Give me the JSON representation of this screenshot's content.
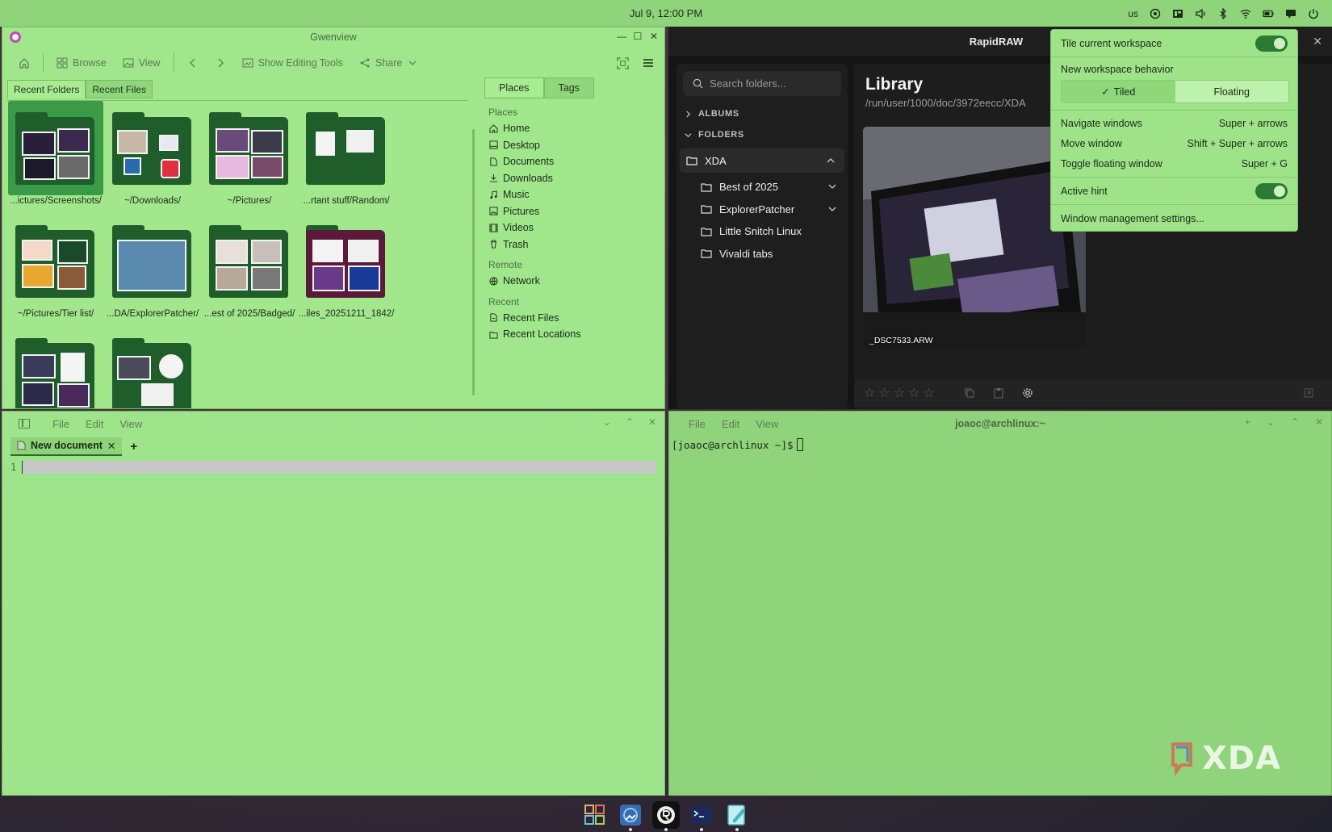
{
  "topbar": {
    "clock": "Jul 9, 12:00 PM",
    "keyboard_layout": "us"
  },
  "gwenview": {
    "title": "Gwenview",
    "toolbar": {
      "browse": "Browse",
      "view": "View",
      "show_editing_tools": "Show Editing Tools",
      "share": "Share"
    },
    "tabs": [
      "Recent Folders",
      "Recent Files"
    ],
    "folders": [
      "...ictures/Screenshots/",
      "~/Downloads/",
      "~/Pictures/",
      "...rtant stuff/Random/",
      "~/Pictures/Tier list/",
      "...DA/ExplorerPatcher/",
      "...est of 2025/Badged/",
      "...iles_20251211_1842/"
    ],
    "places_tabs": [
      "Places",
      "Tags"
    ],
    "places": {
      "heading_places": "Places",
      "items_places": [
        "Home",
        "Desktop",
        "Documents",
        "Downloads",
        "Music",
        "Pictures",
        "Videos",
        "Trash"
      ],
      "heading_remote": "Remote",
      "items_remote": [
        "Network"
      ],
      "heading_recent": "Recent",
      "items_recent": [
        "Recent Files",
        "Recent Locations"
      ]
    }
  },
  "rapidraw": {
    "title": "RapidRAW",
    "search_placeholder": "Search folders...",
    "albums": "ALBUMS",
    "folders_label": "FOLDERS",
    "root_folder": "XDA",
    "subfolders": [
      "Best of 2025",
      "ExplorerPatcher",
      "Little Snitch Linux",
      "Vivaldi tabs"
    ],
    "library_title": "Library",
    "library_path": "/run/user/1000/doc/3972eecc/XDA",
    "photo_name": "_DSC7533.ARW",
    "rating_stars": 5
  },
  "tiling_popup": {
    "tile_current_workspace": "Tile current workspace",
    "new_workspace_behavior": "New workspace behavior",
    "tiled": "Tiled",
    "floating": "Floating",
    "shortcuts": [
      {
        "label": "Navigate windows",
        "keys": "Super + arrows"
      },
      {
        "label": "Move window",
        "keys": "Shift + Super + arrows"
      },
      {
        "label": "Toggle floating window",
        "keys": "Super + G"
      }
    ],
    "active_hint": "Active hint",
    "settings_link": "Window management settings..."
  },
  "editor": {
    "menu": [
      "File",
      "Edit",
      "View"
    ],
    "tab_label": "New document",
    "line_number": "1"
  },
  "terminal": {
    "menu": [
      "File",
      "Edit",
      "View"
    ],
    "title": "joaoc@archlinux:~",
    "prompt": "[joaoc@archlinux ~]$"
  },
  "watermark": "XDA",
  "colors": {
    "accent": "#8fd37a",
    "dark_green": "#1f5e2b",
    "rapidraw_bg": "#151515"
  }
}
